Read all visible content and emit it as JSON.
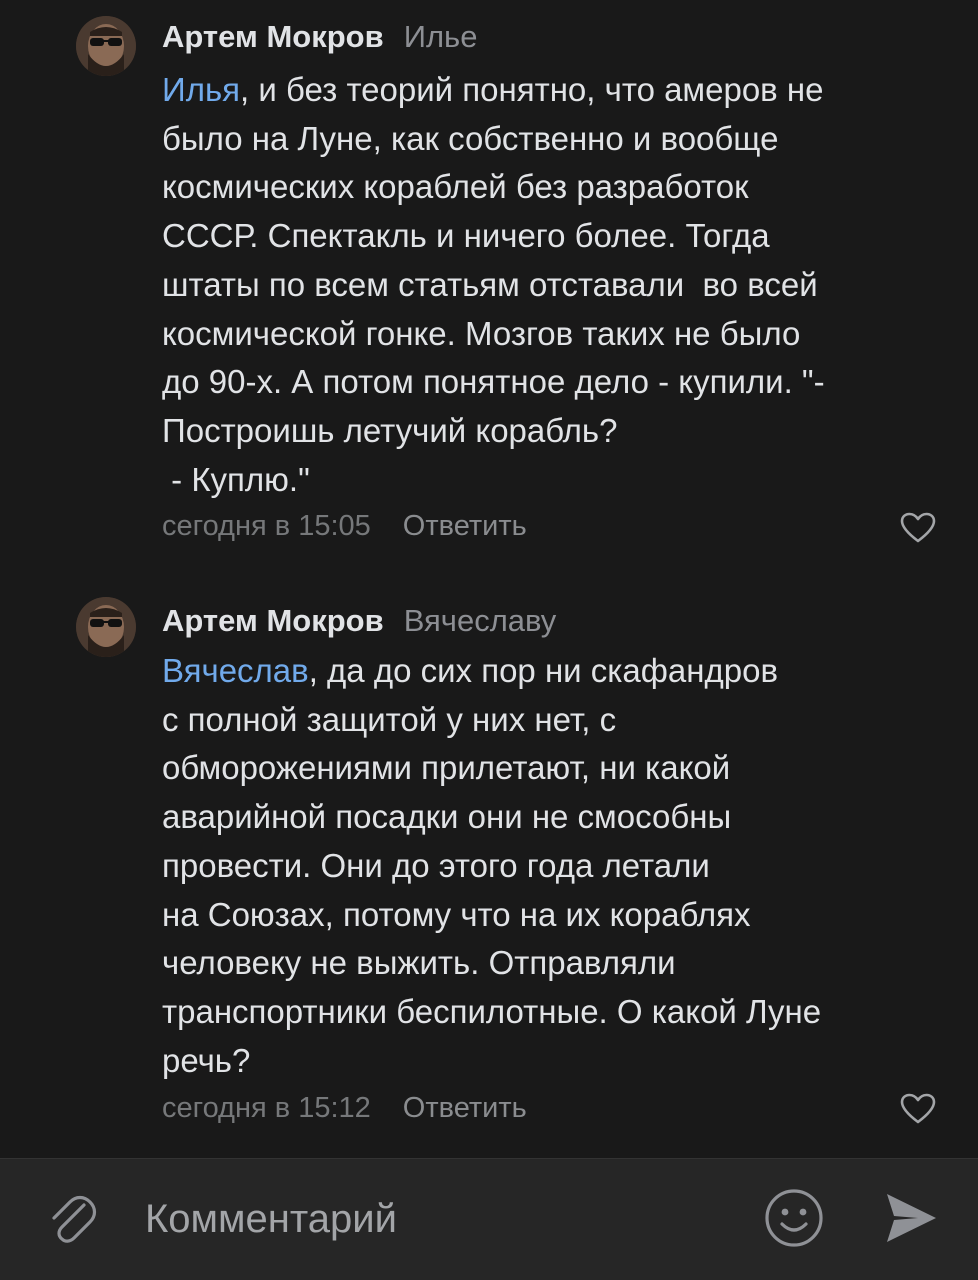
{
  "comments": [
    {
      "author": "Артем Мокров",
      "reply_to": "Илье",
      "mention": "Илья",
      "text": ", и без теорий понятно, что амеров не\nбыло на Луне, как собственно и вообще\nкосмических кораблей без разработок\nСССР. Спектакль и ничего более. Тогда\nштаты по всем статьям отставали  во всей\nкосмической гонке. Мозгов таких не было\nдо 90-х. А потом понятное дело - купили. \"-\nПостроишь летучий корабль?\n - Куплю.\"",
      "time": "сегодня в 15:05",
      "reply_label": "Ответить"
    },
    {
      "author": "Артем Мокров",
      "reply_to": "Вячеславу",
      "mention": "Вячеслав",
      "text": ", да до сих пор ни скафандров\nс полной защитой у них нет, с\nобморожениями прилетают, ни какой\nаварийной посадки они не смособны\nпровести. Они до этого года летали\nна Союзах, потому что на их кораблях\nчеловеку не выжить. Отправляли\nтранспортники беспилотные. О какой Луне\nречь?",
      "time": "сегодня в 15:12",
      "reply_label": "Ответить"
    }
  ],
  "composer": {
    "placeholder": "Комментарий"
  },
  "icons": {
    "attach": "paperclip-icon",
    "emoji": "smile-icon",
    "send": "send-icon",
    "like": "heart-icon"
  },
  "colors": {
    "background": "#191919",
    "composer_background": "#262626",
    "mention": "#71aaeb",
    "secondary_text": "#8d8f94"
  }
}
